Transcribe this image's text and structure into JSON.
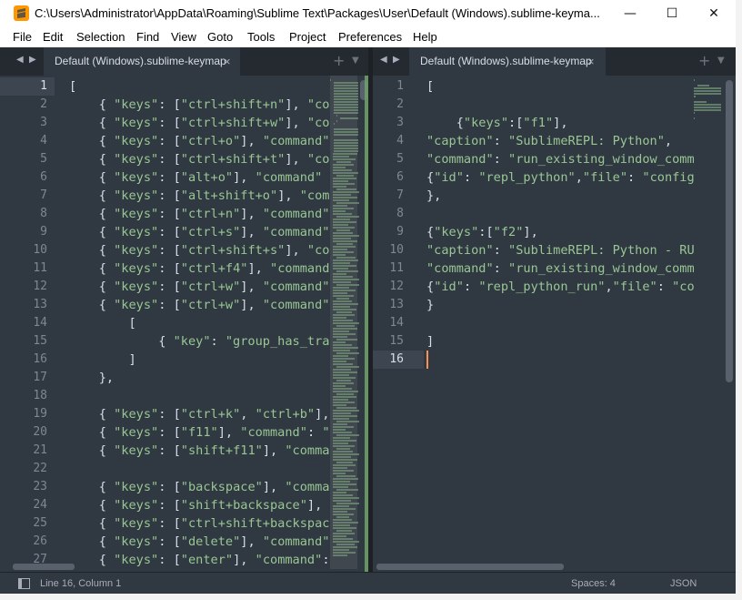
{
  "window": {
    "title": "C:\\Users\\Administrator\\AppData\\Roaming\\Sublime Text\\Packages\\User\\Default (Windows).sublime-keyma...",
    "app_icon": "sublime-text-icon",
    "minimize": "—",
    "maximize": "☐",
    "close": "✕"
  },
  "menu": {
    "items": [
      {
        "key": "F",
        "rest": "ile"
      },
      {
        "key": "E",
        "rest": "dit"
      },
      {
        "key": "S",
        "rest": "election"
      },
      {
        "key": "F",
        "rest": "i",
        "tail": "nd"
      },
      {
        "key": "V",
        "rest": "iew"
      },
      {
        "key": "G",
        "rest": "oto"
      },
      {
        "key": "T",
        "rest": "ools"
      },
      {
        "key": "P",
        "rest": "roject"
      },
      {
        "key": "",
        "rest": "Preferences"
      },
      {
        "key": "H",
        "rest": "elp"
      }
    ],
    "labels": [
      "File",
      "Edit",
      "Selection",
      "Find",
      "View",
      "Goto",
      "Tools",
      "Project",
      "Preferences",
      "Help"
    ]
  },
  "left_pane": {
    "tab_label": "Default (Windows).sublime-keymap",
    "tab_close": "×",
    "nav_prev": "◀",
    "nav_next": "▶",
    "new_tab": "+",
    "tab_menu": "▼",
    "active_line": 1,
    "lines": [
      [
        [
          "p",
          "["
        ]
      ],
      [
        [
          "p",
          "    { "
        ],
        [
          "s",
          "\"keys\""
        ],
        [
          "p",
          ": ["
        ],
        [
          "s",
          "\"ctrl+shift+n\""
        ],
        [
          "p",
          "], "
        ],
        [
          "s",
          "\"co"
        ]
      ],
      [
        [
          "p",
          "    { "
        ],
        [
          "s",
          "\"keys\""
        ],
        [
          "p",
          ": ["
        ],
        [
          "s",
          "\"ctrl+shift+w\""
        ],
        [
          "p",
          "], "
        ],
        [
          "s",
          "\"co"
        ]
      ],
      [
        [
          "p",
          "    { "
        ],
        [
          "s",
          "\"keys\""
        ],
        [
          "p",
          ": ["
        ],
        [
          "s",
          "\"ctrl+o\""
        ],
        [
          "p",
          "], "
        ],
        [
          "s",
          "\"command\""
        ]
      ],
      [
        [
          "p",
          "    { "
        ],
        [
          "s",
          "\"keys\""
        ],
        [
          "p",
          ": ["
        ],
        [
          "s",
          "\"ctrl+shift+t\""
        ],
        [
          "p",
          "], "
        ],
        [
          "s",
          "\"co"
        ]
      ],
      [
        [
          "p",
          "    { "
        ],
        [
          "s",
          "\"keys\""
        ],
        [
          "p",
          ": ["
        ],
        [
          "s",
          "\"alt+o\""
        ],
        [
          "p",
          "], "
        ],
        [
          "s",
          "\"command\""
        ]
      ],
      [
        [
          "p",
          "    { "
        ],
        [
          "s",
          "\"keys\""
        ],
        [
          "p",
          ": ["
        ],
        [
          "s",
          "\"alt+shift+o\""
        ],
        [
          "p",
          "], "
        ],
        [
          "s",
          "\"com"
        ]
      ],
      [
        [
          "p",
          "    { "
        ],
        [
          "s",
          "\"keys\""
        ],
        [
          "p",
          ": ["
        ],
        [
          "s",
          "\"ctrl+n\""
        ],
        [
          "p",
          "], "
        ],
        [
          "s",
          "\"command\""
        ]
      ],
      [
        [
          "p",
          "    { "
        ],
        [
          "s",
          "\"keys\""
        ],
        [
          "p",
          ": ["
        ],
        [
          "s",
          "\"ctrl+s\""
        ],
        [
          "p",
          "], "
        ],
        [
          "s",
          "\"command\""
        ]
      ],
      [
        [
          "p",
          "    { "
        ],
        [
          "s",
          "\"keys\""
        ],
        [
          "p",
          ": ["
        ],
        [
          "s",
          "\"ctrl+shift+s\""
        ],
        [
          "p",
          "], "
        ],
        [
          "s",
          "\"co"
        ]
      ],
      [
        [
          "p",
          "    { "
        ],
        [
          "s",
          "\"keys\""
        ],
        [
          "p",
          ": ["
        ],
        [
          "s",
          "\"ctrl+f4\""
        ],
        [
          "p",
          "], "
        ],
        [
          "s",
          "\"command"
        ]
      ],
      [
        [
          "p",
          "    { "
        ],
        [
          "s",
          "\"keys\""
        ],
        [
          "p",
          ": ["
        ],
        [
          "s",
          "\"ctrl+w\""
        ],
        [
          "p",
          "], "
        ],
        [
          "s",
          "\"command\""
        ]
      ],
      [
        [
          "p",
          "    { "
        ],
        [
          "s",
          "\"keys\""
        ],
        [
          "p",
          ": ["
        ],
        [
          "s",
          "\"ctrl+w\""
        ],
        [
          "p",
          "], "
        ],
        [
          "s",
          "\"command\""
        ]
      ],
      [
        [
          "p",
          "        ["
        ]
      ],
      [
        [
          "p",
          "            { "
        ],
        [
          "s",
          "\"key\""
        ],
        [
          "p",
          ": "
        ],
        [
          "s",
          "\"group_has_tra"
        ]
      ],
      [
        [
          "p",
          "        ]"
        ]
      ],
      [
        [
          "p",
          "    },"
        ]
      ],
      [
        [
          "p",
          ""
        ]
      ],
      [
        [
          "p",
          "    { "
        ],
        [
          "s",
          "\"keys\""
        ],
        [
          "p",
          ": ["
        ],
        [
          "s",
          "\"ctrl+k\""
        ],
        [
          "p",
          ", "
        ],
        [
          "s",
          "\"ctrl+b\""
        ],
        [
          "p",
          "],"
        ]
      ],
      [
        [
          "p",
          "    { "
        ],
        [
          "s",
          "\"keys\""
        ],
        [
          "p",
          ": ["
        ],
        [
          "s",
          "\"f11\""
        ],
        [
          "p",
          "], "
        ],
        [
          "s",
          "\"command\""
        ],
        [
          "p",
          ": "
        ],
        [
          "s",
          "\""
        ]
      ],
      [
        [
          "p",
          "    { "
        ],
        [
          "s",
          "\"keys\""
        ],
        [
          "p",
          ": ["
        ],
        [
          "s",
          "\"shift+f11\""
        ],
        [
          "p",
          "], "
        ],
        [
          "s",
          "\"comma"
        ]
      ],
      [
        [
          "p",
          ""
        ]
      ],
      [
        [
          "p",
          "    { "
        ],
        [
          "s",
          "\"keys\""
        ],
        [
          "p",
          ": ["
        ],
        [
          "s",
          "\"backspace\""
        ],
        [
          "p",
          "], "
        ],
        [
          "s",
          "\"comma"
        ]
      ],
      [
        [
          "p",
          "    { "
        ],
        [
          "s",
          "\"keys\""
        ],
        [
          "p",
          ": ["
        ],
        [
          "s",
          "\"shift+backspace\""
        ],
        [
          "p",
          "],"
        ]
      ],
      [
        [
          "p",
          "    { "
        ],
        [
          "s",
          "\"keys\""
        ],
        [
          "p",
          ": ["
        ],
        [
          "s",
          "\"ctrl+shift+backspac"
        ]
      ],
      [
        [
          "p",
          "    { "
        ],
        [
          "s",
          "\"keys\""
        ],
        [
          "p",
          ": ["
        ],
        [
          "s",
          "\"delete\""
        ],
        [
          "p",
          "], "
        ],
        [
          "s",
          "\"command\""
        ]
      ],
      [
        [
          "p",
          "    { "
        ],
        [
          "s",
          "\"keys\""
        ],
        [
          "p",
          ": ["
        ],
        [
          "s",
          "\"enter\""
        ],
        [
          "p",
          "], "
        ],
        [
          "s",
          "\"command\""
        ],
        [
          "p",
          ":"
        ]
      ]
    ]
  },
  "right_pane": {
    "tab_label": "Default (Windows).sublime-keymap",
    "tab_close": "×",
    "nav_prev": "◀",
    "nav_next": "▶",
    "new_tab": "+",
    "tab_menu": "▼",
    "active_line": 16,
    "lines": [
      [
        [
          "p",
          "["
        ]
      ],
      [
        [
          "p",
          ""
        ]
      ],
      [
        [
          "p",
          "    {"
        ],
        [
          "s",
          "\"keys\""
        ],
        [
          "p",
          ":["
        ],
        [
          "s",
          "\"f1\""
        ],
        [
          "p",
          "],"
        ]
      ],
      [
        [
          "s",
          "\"caption\""
        ],
        [
          "p",
          ": "
        ],
        [
          "s",
          "\"SublimeREPL: Python\""
        ],
        [
          "p",
          ","
        ]
      ],
      [
        [
          "s",
          "\"command\""
        ],
        [
          "p",
          ": "
        ],
        [
          "s",
          "\"run_existing_window_comm"
        ]
      ],
      [
        [
          "p",
          "{"
        ],
        [
          "s",
          "\"id\""
        ],
        [
          "p",
          ": "
        ],
        [
          "s",
          "\"repl_python\""
        ],
        [
          "p",
          ","
        ],
        [
          "s",
          "\"file\""
        ],
        [
          "p",
          ": "
        ],
        [
          "s",
          "\"config"
        ]
      ],
      [
        [
          "p",
          "},"
        ]
      ],
      [
        [
          "p",
          ""
        ]
      ],
      [
        [
          "p",
          "{"
        ],
        [
          "s",
          "\"keys\""
        ],
        [
          "p",
          ":["
        ],
        [
          "s",
          "\"f2\""
        ],
        [
          "p",
          "],"
        ]
      ],
      [
        [
          "s",
          "\"caption\""
        ],
        [
          "p",
          ": "
        ],
        [
          "s",
          "\"SublimeREPL: Python - RU"
        ]
      ],
      [
        [
          "s",
          "\"command\""
        ],
        [
          "p",
          ": "
        ],
        [
          "s",
          "\"run_existing_window_comm"
        ]
      ],
      [
        [
          "p",
          "{"
        ],
        [
          "s",
          "\"id\""
        ],
        [
          "p",
          ": "
        ],
        [
          "s",
          "\"repl_python_run\""
        ],
        [
          "p",
          ","
        ],
        [
          "s",
          "\"file\""
        ],
        [
          "p",
          ": "
        ],
        [
          "s",
          "\"co"
        ]
      ],
      [
        [
          "p",
          "}"
        ]
      ],
      [
        [
          "p",
          ""
        ]
      ],
      [
        [
          "p",
          "]"
        ]
      ],
      [
        [
          "p",
          ""
        ]
      ]
    ]
  },
  "status": {
    "position": "Line 16, Column 1",
    "spaces": "Spaces: 4",
    "syntax": "JSON",
    "panel_icon": "panel-toggle-icon"
  },
  "colors": {
    "background": "#303841",
    "string": "#99c794",
    "text": "#d8dee9",
    "caret": "#f99157",
    "gutter": "#7e8792"
  }
}
